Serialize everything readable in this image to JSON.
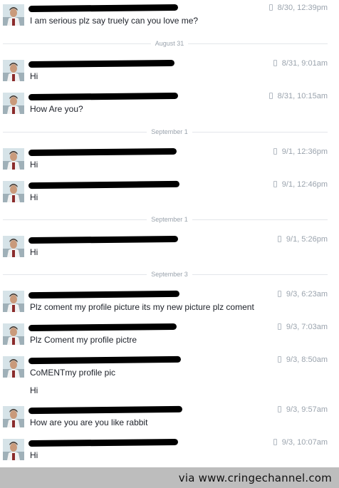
{
  "messages": [
    {
      "time": "8/30, 12:39pm",
      "lines": [
        "I am serious plz say truely can you love me?"
      ]
    },
    {
      "separator": "August 31"
    },
    {
      "time": "8/31, 9:01am",
      "lines": [
        "Hi"
      ]
    },
    {
      "time": "8/31, 10:15am",
      "lines": [
        "How Are you?"
      ]
    },
    {
      "separator": "September 1"
    },
    {
      "time": "9/1, 12:36pm",
      "lines": [
        "Hi"
      ]
    },
    {
      "time": "9/1, 12:46pm",
      "lines": [
        "Hi"
      ]
    },
    {
      "separator": "September 1"
    },
    {
      "time": "9/1, 5:26pm",
      "lines": [
        "Hi"
      ]
    },
    {
      "separator": "September 3"
    },
    {
      "time": "9/3, 6:23am",
      "lines": [
        "Plz coment my profile picture its my new picture plz coment"
      ]
    },
    {
      "time": "9/3, 7:03am",
      "lines": [
        "Plz Coment my profile pictre"
      ]
    },
    {
      "time": "9/3, 8:50am",
      "lines": [
        "CoMENTmy profile pic",
        "Hi"
      ]
    },
    {
      "time": "9/3, 9:57am",
      "lines": [
        "How are you are you like rabbit"
      ]
    },
    {
      "time": "9/3, 10:07am",
      "lines": [
        "Hi"
      ]
    }
  ],
  "footer": {
    "credit": "via www.cringechannel.com"
  }
}
